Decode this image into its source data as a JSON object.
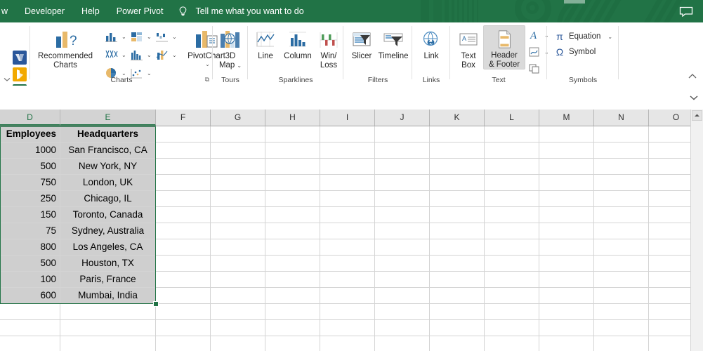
{
  "titlebar": {
    "tabs": [
      {
        "label": "w",
        "name": "tab-view-clipped"
      },
      {
        "label": "Developer",
        "name": "tab-developer"
      },
      {
        "label": "Help",
        "name": "tab-help"
      },
      {
        "label": "Power Pivot",
        "name": "tab-power-pivot"
      }
    ],
    "tell_me": "Tell me what you want to do",
    "bulb_icon": "lightbulb-icon",
    "comment_icon": "comment-icon",
    "accent_color": "#217346"
  },
  "ribbon": {
    "addins": [
      {
        "name": "visio-addin-icon",
        "color": "#2b579a"
      },
      {
        "name": "bing-maps-addin-icon",
        "color": "#f2a900"
      },
      {
        "name": "people-graph-addin-icon",
        "color": "#217346"
      }
    ],
    "addins_overflow_icon": "chevron-down-icon",
    "groups": [
      {
        "name": "charts",
        "label": "Charts",
        "has_dialog_launcher": true,
        "buttons": [
          {
            "label": "Recommended\nCharts",
            "line1": "Recommended",
            "line2": "Charts",
            "name": "recommended-charts-button",
            "icon": "recommended-charts-icon"
          },
          {
            "label": "",
            "name": "column-chart-button",
            "icon": "column-chart-icon",
            "has_caret": true
          },
          {
            "label": "",
            "name": "hierarchy-chart-button",
            "icon": "hierarchy-chart-icon",
            "has_caret": true
          },
          {
            "label": "",
            "name": "waterfall-chart-button",
            "icon": "waterfall-chart-icon",
            "has_caret": true
          },
          {
            "label": "",
            "name": "line-chart-button",
            "icon": "line-chart-icon",
            "has_caret": true
          },
          {
            "label": "",
            "name": "statistic-chart-button",
            "icon": "statistic-chart-icon",
            "has_caret": true
          },
          {
            "label": "",
            "name": "combo-chart-button",
            "icon": "combo-chart-icon",
            "has_caret": true
          },
          {
            "label": "",
            "name": "pie-chart-button",
            "icon": "pie-chart-icon",
            "has_caret": true
          },
          {
            "label": "",
            "name": "scatter-chart-button",
            "icon": "scatter-chart-icon",
            "has_caret": true
          },
          {
            "label": "PivotChart",
            "name": "pivotchart-button",
            "icon": "pivotchart-icon",
            "has_caret": true
          }
        ]
      },
      {
        "name": "tours",
        "label": "Tours",
        "buttons": [
          {
            "line1": "3D",
            "line2": "Map",
            "name": "3d-map-button",
            "icon": "3d-map-icon",
            "has_caret": true
          }
        ]
      },
      {
        "name": "sparklines",
        "label": "Sparklines",
        "buttons": [
          {
            "line1": "Line",
            "line2": "",
            "name": "sparkline-line-button",
            "icon": "sparkline-line-icon"
          },
          {
            "line1": "Column",
            "line2": "",
            "name": "sparkline-column-button",
            "icon": "sparkline-column-icon"
          },
          {
            "line1": "Win/",
            "line2": "Loss",
            "name": "sparkline-winloss-button",
            "icon": "sparkline-winloss-icon"
          }
        ]
      },
      {
        "name": "filters",
        "label": "Filters",
        "buttons": [
          {
            "line1": "Slicer",
            "line2": "",
            "name": "slicer-button",
            "icon": "slicer-icon"
          },
          {
            "line1": "Timeline",
            "line2": "",
            "name": "timeline-button",
            "icon": "timeline-icon"
          }
        ]
      },
      {
        "name": "links",
        "label": "Links",
        "buttons": [
          {
            "line1": "Link",
            "line2": "",
            "name": "link-button",
            "icon": "globe-link-icon"
          }
        ]
      },
      {
        "name": "text",
        "label": "Text",
        "buttons": [
          {
            "line1": "Text",
            "line2": "Box",
            "name": "text-box-button",
            "icon": "text-box-icon"
          },
          {
            "line1": "Header",
            "line2": "& Footer",
            "name": "header-footer-button",
            "icon": "header-footer-icon",
            "selected": true
          },
          {
            "label": "",
            "name": "wordart-button",
            "icon": "wordart-icon",
            "has_caret": true
          },
          {
            "label": "",
            "name": "signature-line-button",
            "icon": "signature-line-icon",
            "has_caret": true
          },
          {
            "label": "",
            "name": "object-button",
            "icon": "object-icon"
          }
        ]
      },
      {
        "name": "symbols",
        "label": "Symbols",
        "buttons": [
          {
            "label": "Equation",
            "name": "equation-button",
            "icon": "pi-icon",
            "has_caret": true
          },
          {
            "label": "Symbol",
            "name": "symbol-button",
            "icon": "omega-icon"
          }
        ]
      }
    ],
    "collapse_icon": "chevron-up-icon"
  },
  "formula_bar": {
    "expand_icon": "chevron-down-icon"
  },
  "sheet": {
    "column_headers": [
      "D",
      "E",
      "F",
      "G",
      "H",
      "I",
      "J",
      "K",
      "L",
      "M",
      "N",
      "O"
    ],
    "selected_columns": [
      "D",
      "E"
    ],
    "table": {
      "headers": [
        "Employees",
        "Headquarters"
      ],
      "rows": [
        {
          "employees": "1000",
          "headquarters": "San Francisco, CA"
        },
        {
          "employees": "500",
          "headquarters": "New York, NY"
        },
        {
          "employees": "750",
          "headquarters": "London, UK"
        },
        {
          "employees": "250",
          "headquarters": "Chicago, IL"
        },
        {
          "employees": "150",
          "headquarters": "Toronto, Canada"
        },
        {
          "employees": "75",
          "headquarters": "Sydney, Australia"
        },
        {
          "employees": "800",
          "headquarters": "Los Angeles, CA"
        },
        {
          "employees": "500",
          "headquarters": "Houston, TX"
        },
        {
          "employees": "100",
          "headquarters": "Paris, France"
        },
        {
          "employees": "600",
          "headquarters": "Mumbai, India"
        }
      ]
    },
    "selection_color": "#217346",
    "selection_fill": "#cfcfcf",
    "scroll_up_icon": "scroll-up-arrow-icon"
  }
}
